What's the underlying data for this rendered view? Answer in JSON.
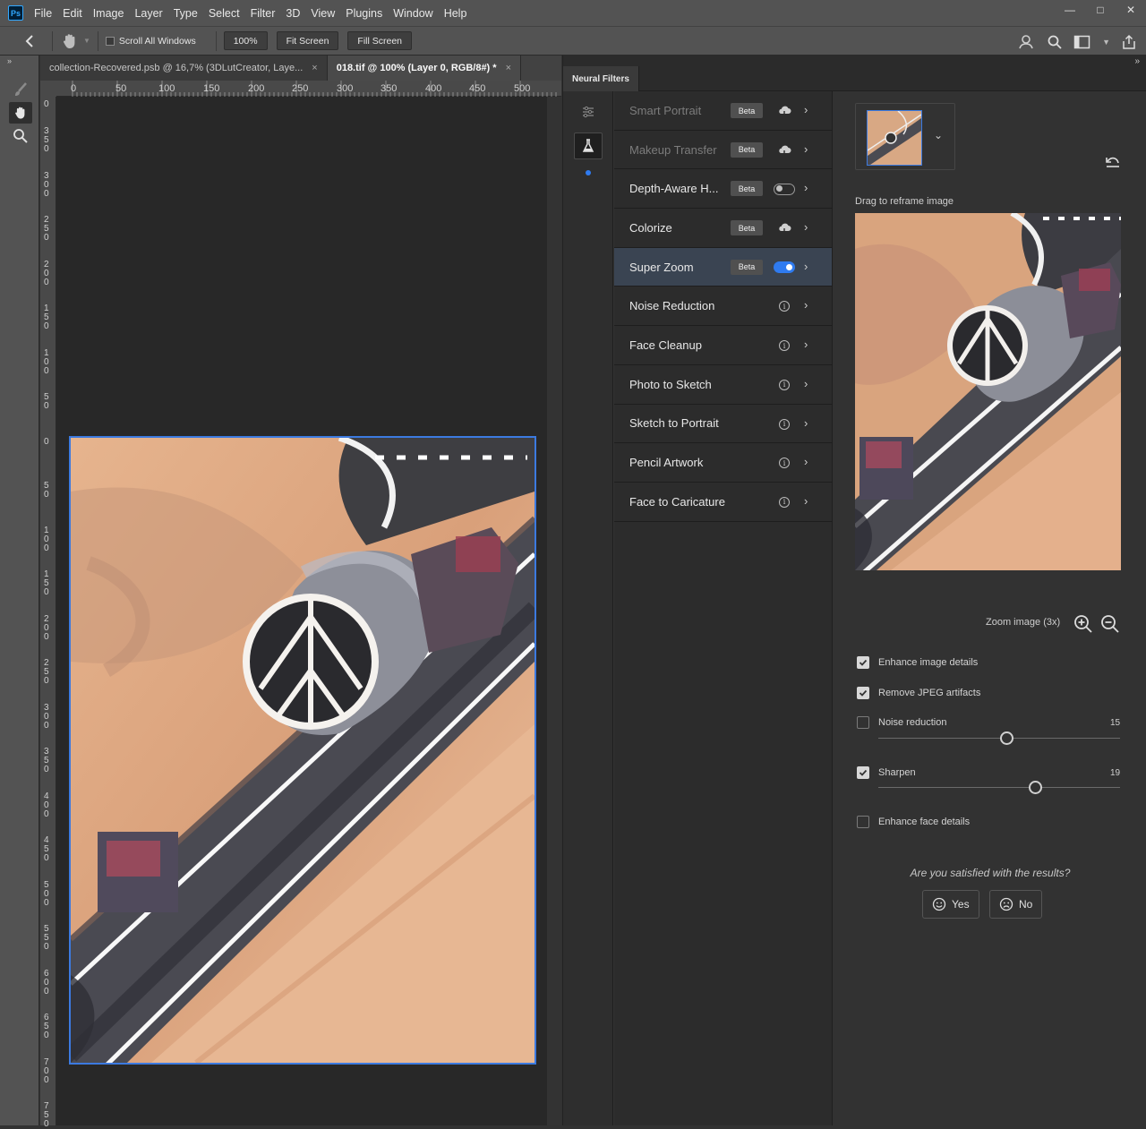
{
  "menu": {
    "logo": "Ps",
    "items": [
      "File",
      "Edit",
      "Image",
      "Layer",
      "Type",
      "Select",
      "Filter",
      "3D",
      "View",
      "Plugins",
      "Window",
      "Help"
    ]
  },
  "options": {
    "scroll_all_windows": "Scroll All Windows",
    "zoom_100": "100%",
    "fit_screen": "Fit Screen",
    "fill_screen": "Fill Screen"
  },
  "tabs": [
    {
      "label": "collection-Recovered.psb @ 16,7% (3DLutCreator, Laye...",
      "close": "×"
    },
    {
      "label": "018.tif @ 100% (Layer 0, RGB/8#) *",
      "close": "×"
    }
  ],
  "ruler": {
    "h_labels": [
      "0",
      "50",
      "100",
      "150",
      "200",
      "250",
      "300",
      "350",
      "400",
      "450",
      "500"
    ],
    "v_labels": [
      "0",
      "350",
      "300",
      "250",
      "200",
      "150",
      "100",
      "50",
      "0",
      "50",
      "100",
      "150",
      "200",
      "250",
      "300",
      "350",
      "400",
      "450",
      "500",
      "550",
      "600",
      "650",
      "700",
      "750"
    ]
  },
  "neural_filters": {
    "panel_title": "Neural Filters",
    "filters": [
      {
        "name": "Smart Portrait",
        "badge": "Beta",
        "control": "cloud",
        "dim": true
      },
      {
        "name": "Makeup Transfer",
        "badge": "Beta",
        "control": "cloud",
        "dim": true
      },
      {
        "name": "Depth-Aware H...",
        "badge": "Beta",
        "control": "toggle-off",
        "dim": false
      },
      {
        "name": "Colorize",
        "badge": "Beta",
        "control": "cloud",
        "dim": false
      },
      {
        "name": "Super Zoom",
        "badge": "Beta",
        "control": "toggle-on",
        "dim": false,
        "selected": true
      },
      {
        "name": "Noise Reduction",
        "badge": "",
        "control": "info",
        "dim": false
      },
      {
        "name": "Face Cleanup",
        "badge": "",
        "control": "info",
        "dim": false
      },
      {
        "name": "Photo to Sketch",
        "badge": "",
        "control": "info",
        "dim": false
      },
      {
        "name": "Sketch to Portrait",
        "badge": "",
        "control": "info",
        "dim": false
      },
      {
        "name": "Pencil Artwork",
        "badge": "",
        "control": "info",
        "dim": false
      },
      {
        "name": "Face to Caricature",
        "badge": "",
        "control": "info",
        "dim": false
      }
    ],
    "settings": {
      "drag_label": "Drag to reframe image",
      "zoom_label": "Zoom image (3x)",
      "enhance_details": "Enhance image details",
      "remove_jpeg": "Remove JPEG artifacts",
      "noise_reduction": "Noise reduction",
      "noise_value": "15",
      "noise_fraction": 0.53,
      "sharpen": "Sharpen",
      "sharpen_value": "19",
      "sharpen_fraction": 0.65,
      "enhance_face": "Enhance face details",
      "satisfied_q": "Are you satisfied with the results?",
      "yes": "Yes",
      "no": "No"
    }
  },
  "colors": {
    "accent": "#2f7bf0",
    "selection_border": "#3c7ae0"
  }
}
